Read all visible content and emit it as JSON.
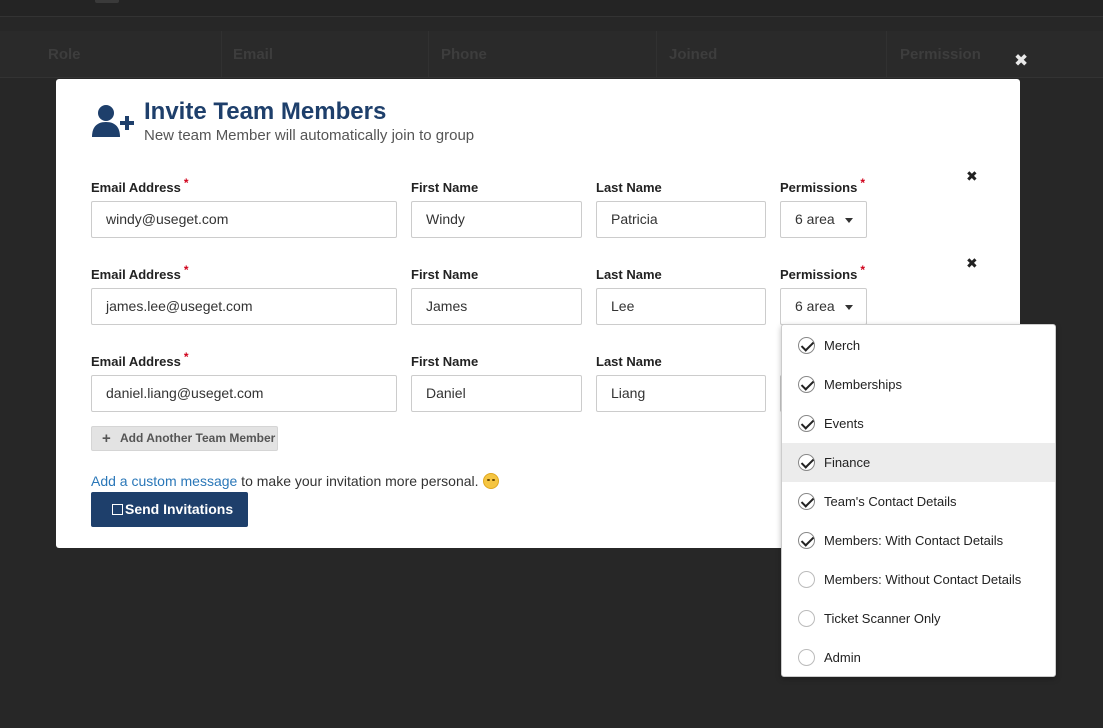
{
  "background": {
    "columns": [
      "Role",
      "Email",
      "Phone",
      "Joined",
      "Permission"
    ]
  },
  "modal": {
    "title": "Invite Team Members",
    "subtitle": "New team Member will automatically join to group",
    "labels": {
      "email": "Email Address",
      "first_name": "First Name",
      "last_name": "Last Name",
      "permissions": "Permissions",
      "required_mark": "*"
    },
    "members": [
      {
        "email": "windy@useget.com",
        "first_name": "Windy",
        "last_name": "Patricia",
        "permissions": "6 area"
      },
      {
        "email": "james.lee@useget.com",
        "first_name": "James",
        "last_name": "Lee",
        "permissions": "6 area"
      },
      {
        "email": "daniel.liang@useget.com",
        "first_name": "Daniel",
        "last_name": "Liang"
      }
    ],
    "add_button": "Add Another Team Member",
    "custom_message_link": "Add a custom message",
    "custom_message_rest": " to make your invitation more personal.",
    "send_button": "Send Invitations"
  },
  "permissions_dropdown": {
    "items": [
      {
        "label": "Merch",
        "checked": true
      },
      {
        "label": "Memberships",
        "checked": true
      },
      {
        "label": "Events",
        "checked": true
      },
      {
        "label": "Finance",
        "checked": true,
        "highlighted": true
      },
      {
        "label": "Team's Contact Details",
        "checked": true
      },
      {
        "label": "Members: With Contact Details",
        "checked": true
      },
      {
        "label": "Members: Without Contact Details",
        "checked": false
      },
      {
        "label": "Ticket Scanner Only",
        "checked": false
      },
      {
        "label": "Admin",
        "checked": false
      }
    ]
  },
  "colors": {
    "primary": "#1e3f6b",
    "link": "#2a77b8",
    "required": "#d0021b"
  }
}
